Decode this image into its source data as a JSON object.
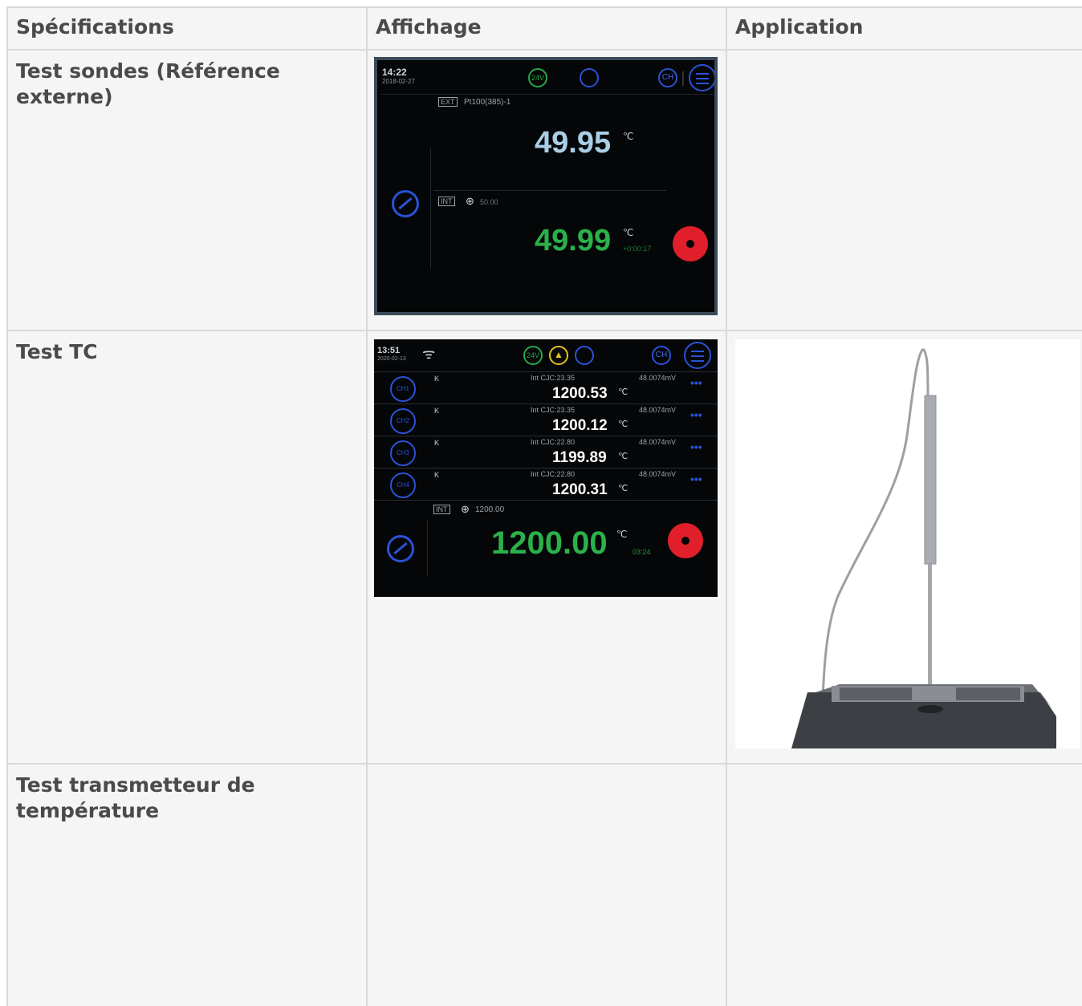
{
  "table": {
    "headers": [
      "Spécifications",
      "Affichage",
      "Application"
    ],
    "rows": [
      {
        "spec": "Test sondes (Référence externe)"
      },
      {
        "spec": "Test TC"
      },
      {
        "spec": "Test transmetteur de température"
      }
    ]
  },
  "screen1": {
    "time": "14:22",
    "date": "2018-02-27",
    "badge_24v": "24V",
    "badge_ch": "CH",
    "ext_tag": "EXT",
    "probe": "Pt100(385)-1",
    "ext_value": "49.95",
    "unit": "℃",
    "int_tag": "INT",
    "setpoint": "50.00",
    "int_value": "49.99",
    "elapsed": "+0:00:17"
  },
  "screen2": {
    "time": "13:51",
    "date": "2020-02-13",
    "badge_24v": "24V",
    "badge_ch": "CH",
    "unit": "℃",
    "channels": [
      {
        "ch": "CH1",
        "type": "K",
        "cjc": "Int CJC:23.35",
        "mv": "48.0074mV",
        "value": "1200.53"
      },
      {
        "ch": "CH2",
        "type": "K",
        "cjc": "Int CJC:23.35",
        "mv": "48.0074mV",
        "value": "1200.12"
      },
      {
        "ch": "CH3",
        "type": "K",
        "cjc": "Int CJC:22.80",
        "mv": "48.0074mV",
        "value": "1199.89"
      },
      {
        "ch": "CH4",
        "type": "K",
        "cjc": "Int CJC:22.80",
        "mv": "48.0074mV",
        "value": "1200.31"
      }
    ],
    "int_tag": "INT",
    "setpoint": "1200.00",
    "main_value": "1200.00",
    "elapsed": "03:24"
  },
  "colors": {
    "cell_bg": "#f5f5f5",
    "border": "#d9d9d9",
    "text": "#4a4a4a",
    "screen_bg": "#050607",
    "ext_value": "#a8cfe6",
    "int_value": "#2bb14a",
    "icon_blue": "#2a52d8",
    "fan_red": "#e01f2a"
  }
}
